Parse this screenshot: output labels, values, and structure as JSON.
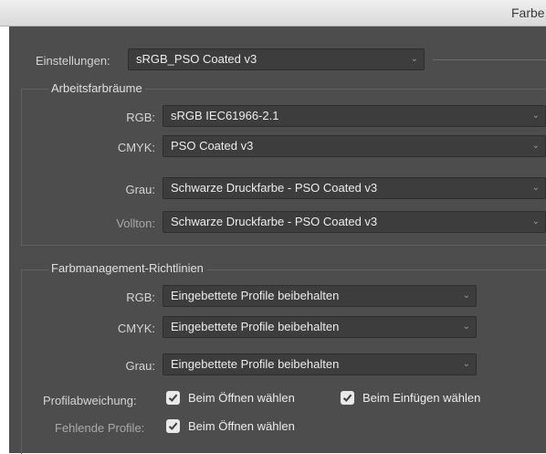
{
  "window": {
    "title": "Farbe"
  },
  "settings": {
    "label": "Einstellungen:",
    "value": "sRGB_PSO Coated v3"
  },
  "workspaces": {
    "title": "Arbeitsfarbräume",
    "rows": [
      {
        "label": "RGB:",
        "value": "sRGB IEC61966-2.1"
      },
      {
        "label": "CMYK:",
        "value": "PSO Coated v3"
      },
      {
        "label": "Grau:",
        "value": "Schwarze Druckfarbe - PSO Coated v3"
      },
      {
        "label": "Vollton:",
        "value": "Schwarze Druckfarbe - PSO Coated v3"
      }
    ]
  },
  "policies": {
    "title": "Farbmanagement-Richtlinien",
    "rows": [
      {
        "label": "RGB:",
        "value": "Eingebettete Profile beibehalten"
      },
      {
        "label": "CMYK:",
        "value": "Eingebettete Profile beibehalten"
      },
      {
        "label": "Grau:",
        "value": "Eingebettete Profile beibehalten"
      }
    ],
    "mismatch": {
      "label": "Profilabweichung:",
      "options": [
        {
          "label": "Beim Öffnen wählen",
          "checked": true
        },
        {
          "label": "Beim Einfügen wählen",
          "checked": true
        }
      ]
    },
    "missing": {
      "label": "Fehlende Profile:",
      "options": [
        {
          "label": "Beim Öffnen wählen",
          "checked": true
        }
      ]
    }
  },
  "icons": {
    "dropdown": "chevron-down-icon",
    "checkbox": "checkmark-icon"
  },
  "colors": {
    "panel": "#4d4d4d",
    "field": "#3d3d3d",
    "text": "#ededed",
    "label": "#d5d5d5"
  }
}
